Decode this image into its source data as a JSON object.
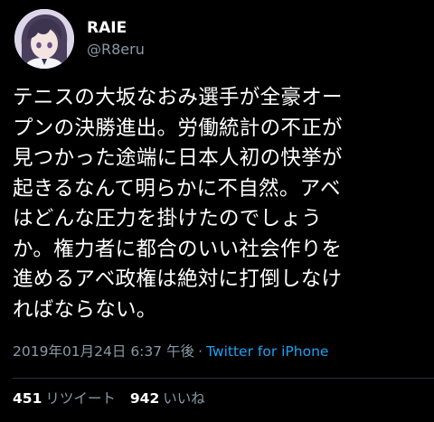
{
  "user": {
    "display_name": "RAIE",
    "handle": "@R8eru",
    "avatar": "anime-character-avatar"
  },
  "tweet": {
    "lines": [
      "テニスの大坂なおみ選手が全豪オー",
      "プンの決勝進出。労働統計の不正が",
      "見つかった途端に日本人初の快挙が",
      "起きるなんて明らかに不自然。アベ",
      "はどんな圧力を掛けたのでしょう",
      "か。権力者に都合のいい社会作りを",
      "進めるアベ政権は絶対に打倒しなけ",
      "ればならない。"
    ],
    "timestamp": "2019年01月24日 6:37 午後",
    "separator": "·",
    "source": "Twitter for iPhone"
  },
  "stats": {
    "retweets_count": "451",
    "retweets_label": "リツイート",
    "likes_count": "942",
    "likes_label": "いいね"
  },
  "colors": {
    "background": "#000000",
    "text": "#ffffff",
    "secondary": "#8899a6",
    "link": "#1da1f2",
    "divider": "#2f3336"
  }
}
